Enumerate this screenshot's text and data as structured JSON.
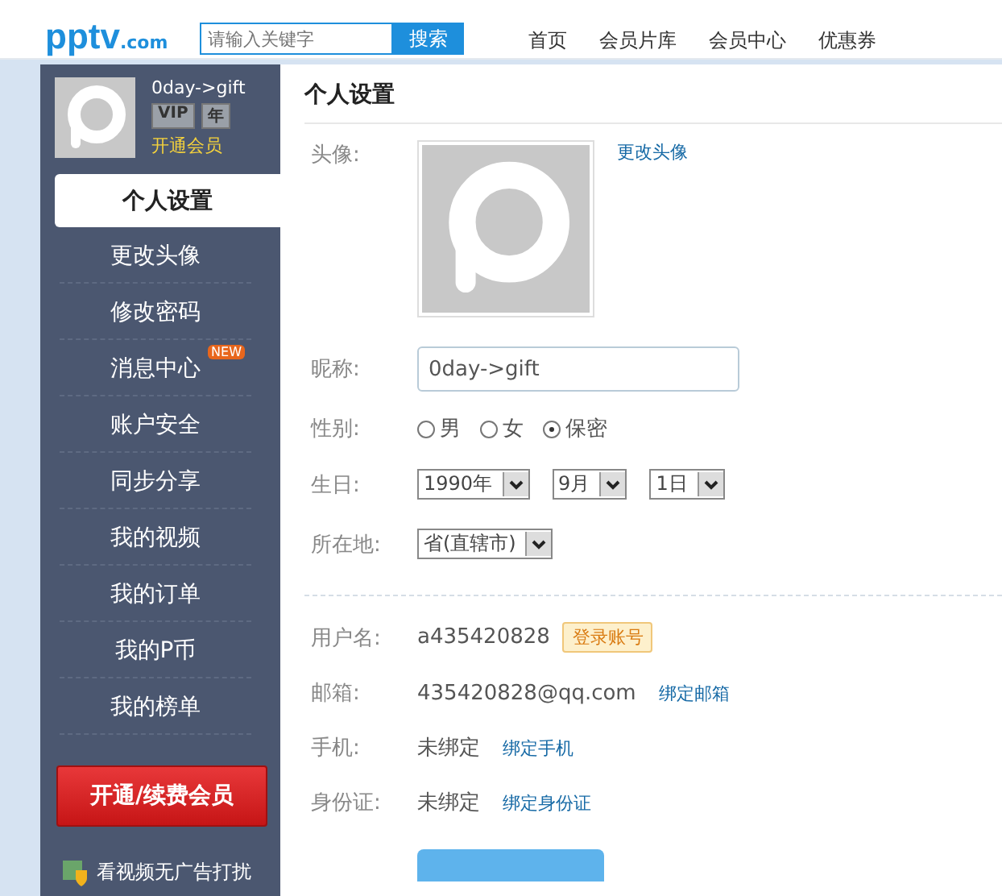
{
  "header": {
    "logo": "pptv",
    "logo_suffix": ".com",
    "search": {
      "placeholder": "请输入关键字"
    },
    "search_button": "搜索",
    "nav": [
      "首页",
      "会员片库",
      "会员中心",
      "优惠券"
    ]
  },
  "sidebar": {
    "user": {
      "name": "0day->gift",
      "badges": [
        "VIP",
        "年"
      ],
      "link": "开通会员"
    },
    "items": [
      {
        "label": "个人设置",
        "selected": true
      },
      {
        "label": "更改头像",
        "selected": false
      },
      {
        "label": "修改密码",
        "selected": false
      },
      {
        "label": "消息中心",
        "selected": false,
        "badge": "NEW"
      },
      {
        "label": "账户安全",
        "selected": false
      },
      {
        "label": "同步分享",
        "selected": false
      },
      {
        "label": "我的视频",
        "selected": false
      },
      {
        "label": "我的订单",
        "selected": false
      },
      {
        "label": "我的P币",
        "selected": false
      },
      {
        "label": "我的榜单",
        "selected": false
      }
    ],
    "cta": "开通/续费会员",
    "promo": "看视频无广告打扰"
  },
  "content": {
    "title": "个人设置",
    "avatar": {
      "label": "头像:",
      "link": "更改头像"
    },
    "nickname": {
      "label": "昵称:",
      "value": "0day->gift"
    },
    "gender": {
      "label": "性别:",
      "options": [
        {
          "label": "男",
          "selected": false
        },
        {
          "label": "女",
          "selected": false
        },
        {
          "label": "保密",
          "selected": true
        }
      ]
    },
    "birthday": {
      "label": "生日:",
      "selects": [
        "1990年",
        "9月",
        "1日"
      ]
    },
    "location": {
      "label": "所在地:",
      "selects": [
        "省(直辖市)"
      ]
    },
    "account": [
      {
        "label": "用户名:",
        "value": "a435420828",
        "tag": "登录账号"
      },
      {
        "label": "邮箱:",
        "value": "435420828@qq.com",
        "link": "绑定邮箱"
      },
      {
        "label": "手机:",
        "value": "未绑定",
        "link": "绑定手机"
      },
      {
        "label": "身份证:",
        "value": "未绑定",
        "link": "绑定身份证"
      }
    ]
  }
}
